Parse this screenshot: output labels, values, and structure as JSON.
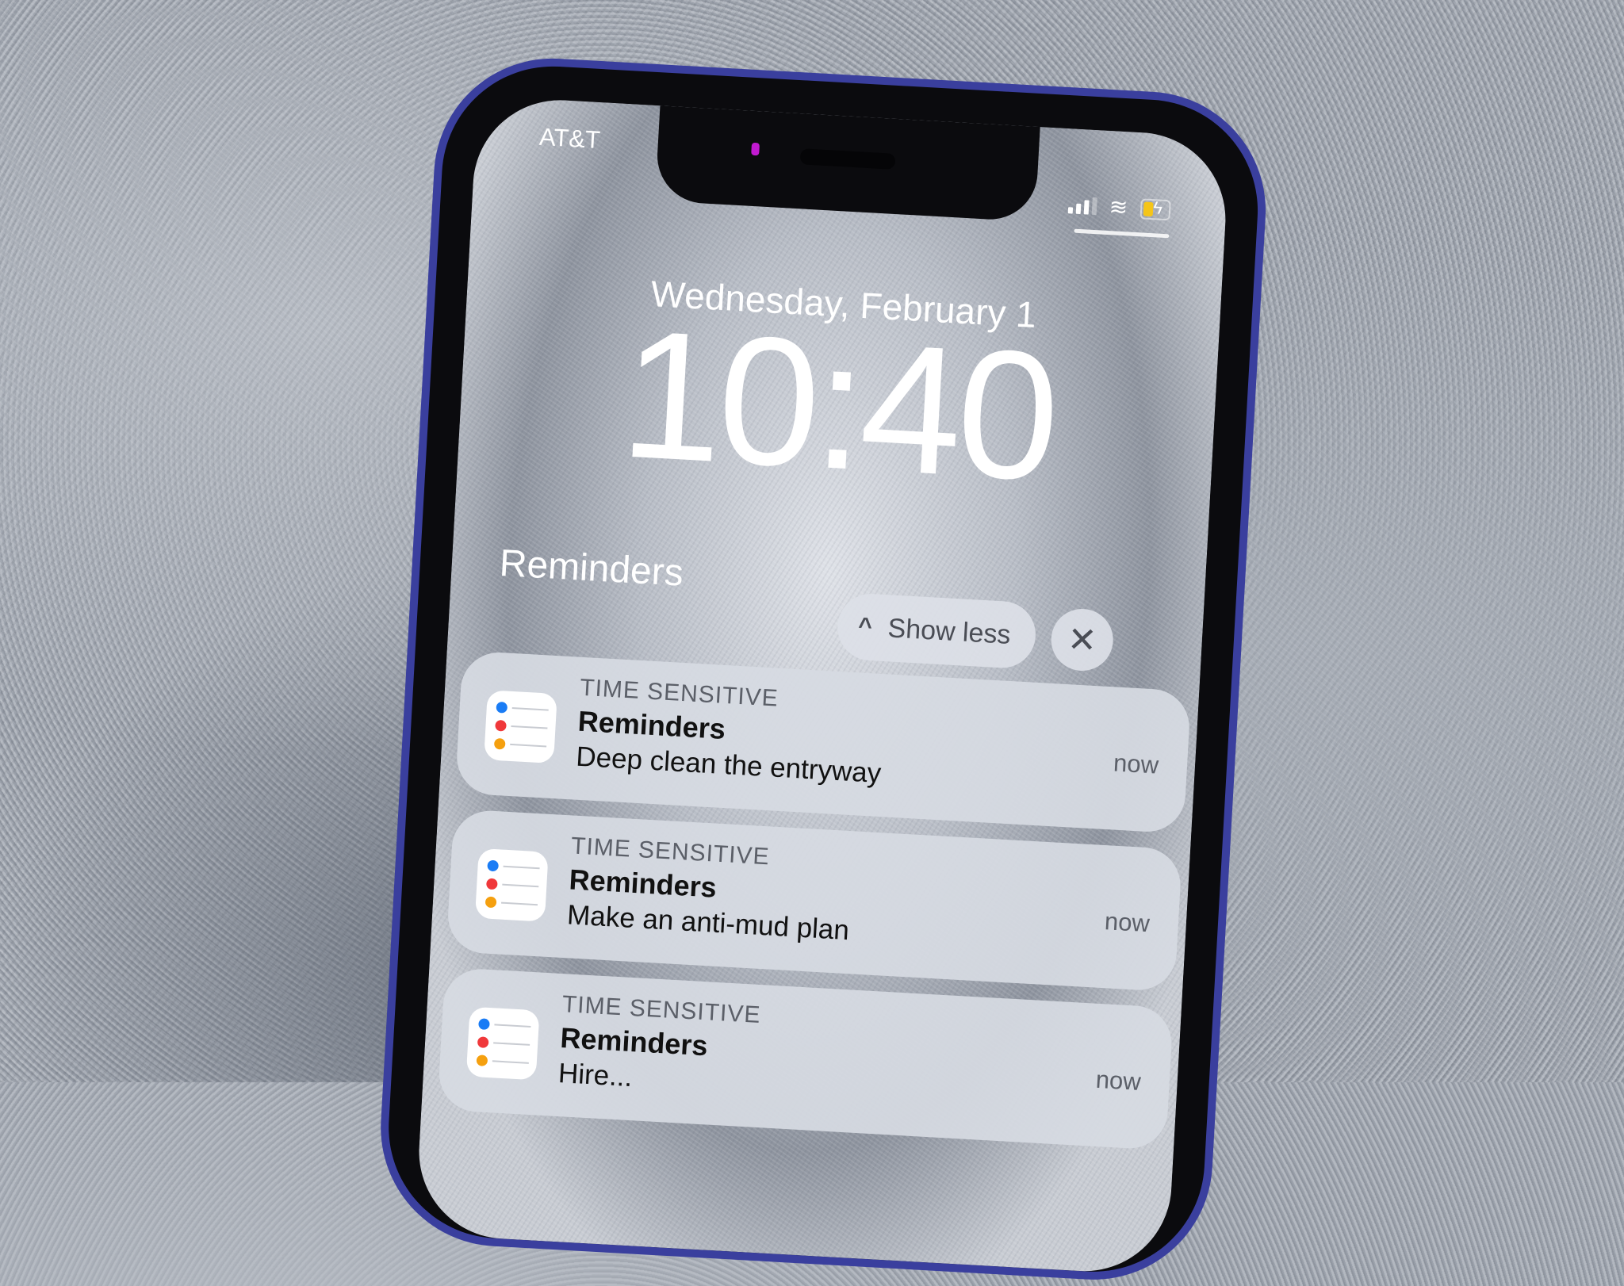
{
  "status_bar": {
    "carrier": "AT&T",
    "signal_icon": "cellular-signal-icon",
    "wifi_icon": "wifi-icon",
    "battery_icon": "battery-charging-icon",
    "battery_color": "#f5c518"
  },
  "lock_screen": {
    "date": "Wednesday, February 1",
    "time": "10:40"
  },
  "notification_group": {
    "title": "Reminders",
    "show_less_label": "Show less",
    "show_less_icon": "chevron-up-icon",
    "close_icon": "close-icon",
    "close_glyph": "✕",
    "chevron_glyph": "^"
  },
  "notifications": [
    {
      "tag": "TIME SENSITIVE",
      "app": "Reminders",
      "body": "Deep clean the entryway",
      "time": "now",
      "icon": "reminders-app-icon"
    },
    {
      "tag": "TIME SENSITIVE",
      "app": "Reminders",
      "body": "Make an anti-mud plan",
      "time": "now",
      "icon": "reminders-app-icon"
    },
    {
      "tag": "TIME SENSITIVE",
      "app": "Reminders",
      "body": "Hire...",
      "time": "now",
      "icon": "reminders-app-icon"
    }
  ],
  "reminder_icon_colors": [
    "#1a7cf5",
    "#f0383a",
    "#f5a00f"
  ]
}
